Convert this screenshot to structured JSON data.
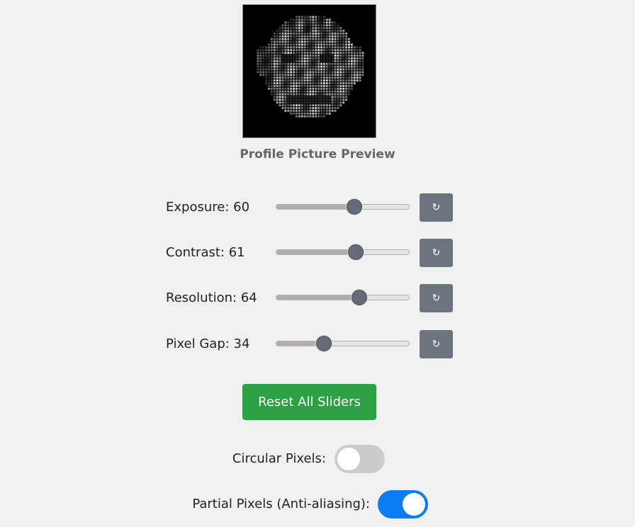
{
  "preview": {
    "caption": "Profile Picture Preview"
  },
  "sliders": [
    {
      "label": "Exposure: 60",
      "value": 60,
      "reset_icon": "↻"
    },
    {
      "label": "Contrast: 61",
      "value": 61,
      "reset_icon": "↻"
    },
    {
      "label": "Resolution: 64",
      "value": 64,
      "reset_icon": "↻"
    },
    {
      "label": "Pixel Gap: 34",
      "value": 34,
      "reset_icon": "↻"
    }
  ],
  "reset_all_label": "Reset All Sliders",
  "toggles": {
    "circular": {
      "label": "Circular Pixels:",
      "on": false
    },
    "partial": {
      "label": "Partial Pixels (Anti-aliasing):",
      "on": true
    }
  },
  "colors": {
    "background": "#f0f0f0",
    "reset_all": "#2da044",
    "toggle_on": "#0a7cf2",
    "toggle_off": "#cccccc",
    "reset_button": "#6d747d"
  }
}
